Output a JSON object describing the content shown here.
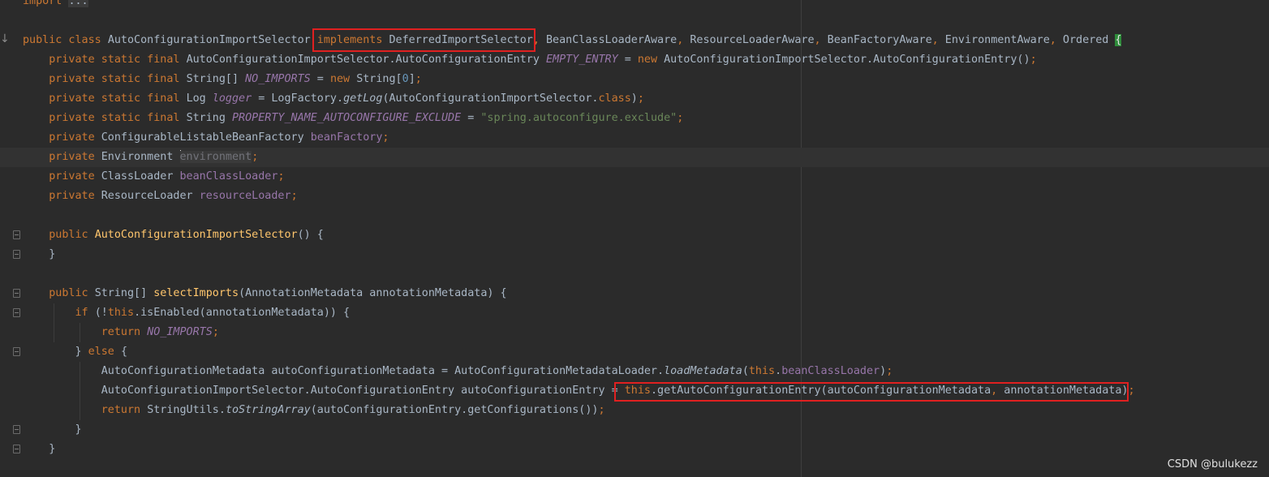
{
  "lines": [
    [
      [
        "kw",
        "import"
      ],
      [
        "plain",
        " "
      ],
      [
        "fold",
        "..."
      ]
    ],
    [],
    [
      [
        "kw",
        "public class "
      ],
      [
        "plain",
        "AutoConfigurationImportSelector "
      ],
      [
        "kw",
        "implements "
      ],
      [
        "plain",
        "DeferredImportSelector"
      ],
      [
        "kw",
        ", "
      ],
      [
        "plain",
        "BeanClassLoaderAware"
      ],
      [
        "kw",
        ", "
      ],
      [
        "plain",
        "ResourceLoaderAware"
      ],
      [
        "kw",
        ", "
      ],
      [
        "plain",
        "BeanFactoryAware"
      ],
      [
        "kw",
        ", "
      ],
      [
        "plain",
        "EnvironmentAware"
      ],
      [
        "kw",
        ", "
      ],
      [
        "plain",
        "Ordered "
      ],
      [
        "brace",
        "{"
      ]
    ],
    [
      [
        "plain",
        "    "
      ],
      [
        "kw",
        "private static final "
      ],
      [
        "plain",
        "AutoConfigurationImportSelector.AutoConfigurationEntry "
      ],
      [
        "const",
        "EMPTY_ENTRY"
      ],
      [
        "plain",
        " = "
      ],
      [
        "kw",
        "new "
      ],
      [
        "plain",
        "AutoConfigurationImportSelector.AutoConfigurationEntry()"
      ],
      [
        "kw",
        ";"
      ]
    ],
    [
      [
        "plain",
        "    "
      ],
      [
        "kw",
        "private static final "
      ],
      [
        "plain",
        "String[] "
      ],
      [
        "const",
        "NO_IMPORTS"
      ],
      [
        "plain",
        " = "
      ],
      [
        "kw",
        "new "
      ],
      [
        "plain",
        "String["
      ],
      [
        "num",
        "0"
      ],
      [
        "plain",
        "]"
      ],
      [
        "kw",
        ";"
      ]
    ],
    [
      [
        "plain",
        "    "
      ],
      [
        "kw",
        "private static final "
      ],
      [
        "plain",
        "Log "
      ],
      [
        "const",
        "logger"
      ],
      [
        "plain",
        " = LogFactory."
      ],
      [
        "static",
        "getLog"
      ],
      [
        "plain",
        "(AutoConfigurationImportSelector."
      ],
      [
        "kw",
        "class"
      ],
      [
        "plain",
        ")"
      ],
      [
        "kw",
        ";"
      ]
    ],
    [
      [
        "plain",
        "    "
      ],
      [
        "kw",
        "private static final "
      ],
      [
        "plain",
        "String "
      ],
      [
        "const",
        "PROPERTY_NAME_AUTOCONFIGURE_EXCLUDE"
      ],
      [
        "plain",
        " = "
      ],
      [
        "string",
        "\"spring.autoconfigure.exclude\""
      ],
      [
        "kw",
        ";"
      ]
    ],
    [
      [
        "plain",
        "    "
      ],
      [
        "kw",
        "private "
      ],
      [
        "plain",
        "ConfigurableListableBeanFactory "
      ],
      [
        "field",
        "beanFactory"
      ],
      [
        "kw",
        ";"
      ]
    ],
    [
      [
        "plain",
        "    "
      ],
      [
        "kw",
        "private "
      ],
      [
        "plain",
        "Environment "
      ],
      [
        "caret",
        ""
      ],
      [
        "unused",
        "environment"
      ],
      [
        "kw",
        ";"
      ]
    ],
    [
      [
        "plain",
        "    "
      ],
      [
        "kw",
        "private "
      ],
      [
        "plain",
        "ClassLoader "
      ],
      [
        "field",
        "beanClassLoader"
      ],
      [
        "kw",
        ";"
      ]
    ],
    [
      [
        "plain",
        "    "
      ],
      [
        "kw",
        "private "
      ],
      [
        "plain",
        "ResourceLoader "
      ],
      [
        "field",
        "resourceLoader"
      ],
      [
        "kw",
        ";"
      ]
    ],
    [],
    [
      [
        "plain",
        "    "
      ],
      [
        "kw",
        "public "
      ],
      [
        "method",
        "AutoConfigurationImportSelector"
      ],
      [
        "plain",
        "() {"
      ]
    ],
    [
      [
        "plain",
        "    }"
      ]
    ],
    [],
    [
      [
        "plain",
        "    "
      ],
      [
        "kw",
        "public "
      ],
      [
        "plain",
        "String[] "
      ],
      [
        "method",
        "selectImports"
      ],
      [
        "plain",
        "(AnnotationMetadata annotationMetadata) {"
      ]
    ],
    [
      [
        "plain",
        "        "
      ],
      [
        "kw",
        "if "
      ],
      [
        "plain",
        "(!"
      ],
      [
        "kw",
        "this"
      ],
      [
        "plain",
        ".isEnabled(annotationMetadata)) {"
      ]
    ],
    [
      [
        "plain",
        "            "
      ],
      [
        "kw",
        "return "
      ],
      [
        "const",
        "NO_IMPORTS"
      ],
      [
        "kw",
        ";"
      ]
    ],
    [
      [
        "plain",
        "        } "
      ],
      [
        "kw",
        "else "
      ],
      [
        "plain",
        "{"
      ]
    ],
    [
      [
        "plain",
        "            AutoConfigurationMetadata autoConfigurationMetadata = AutoConfigurationMetadataLoader."
      ],
      [
        "static",
        "loadMetadata"
      ],
      [
        "plain",
        "("
      ],
      [
        "kw",
        "this"
      ],
      [
        "plain",
        "."
      ],
      [
        "field",
        "beanClassLoader"
      ],
      [
        "plain",
        ")"
      ],
      [
        "kw",
        ";"
      ]
    ],
    [
      [
        "plain",
        "            AutoConfigurationImportSelector.AutoConfigurationEntry autoConfigurationEntry = "
      ],
      [
        "kw",
        "this"
      ],
      [
        "plain",
        ".getAutoConfigurationEntry(autoConfigurationMetadata"
      ],
      [
        "kw",
        ", "
      ],
      [
        "plain",
        "annotationMetadata)"
      ],
      [
        "kw",
        ";"
      ]
    ],
    [
      [
        "plain",
        "            "
      ],
      [
        "kw",
        "return "
      ],
      [
        "plain",
        "StringUtils."
      ],
      [
        "static",
        "toStringArray"
      ],
      [
        "plain",
        "(autoConfigurationEntry.getConfigurations())"
      ],
      [
        "kw",
        ";"
      ]
    ],
    [
      [
        "plain",
        "        }"
      ]
    ],
    [
      [
        "plain",
        "    }"
      ]
    ]
  ],
  "current_line": 8,
  "watermark": "CSDN @bulukezz",
  "icons": {
    "gutter_arrow": "down-arrow-icon",
    "intention": "lightbulb-icon",
    "fold": "fold-icon"
  },
  "colors": {
    "background": "#2b2b2b",
    "keyword": "#cc7832",
    "text": "#a9b7c6",
    "field": "#9876aa",
    "method": "#ffc66d",
    "string": "#6a8759",
    "number": "#6897bb",
    "annotation_box": "#e02020",
    "brace_match": "#2e8b3a"
  }
}
